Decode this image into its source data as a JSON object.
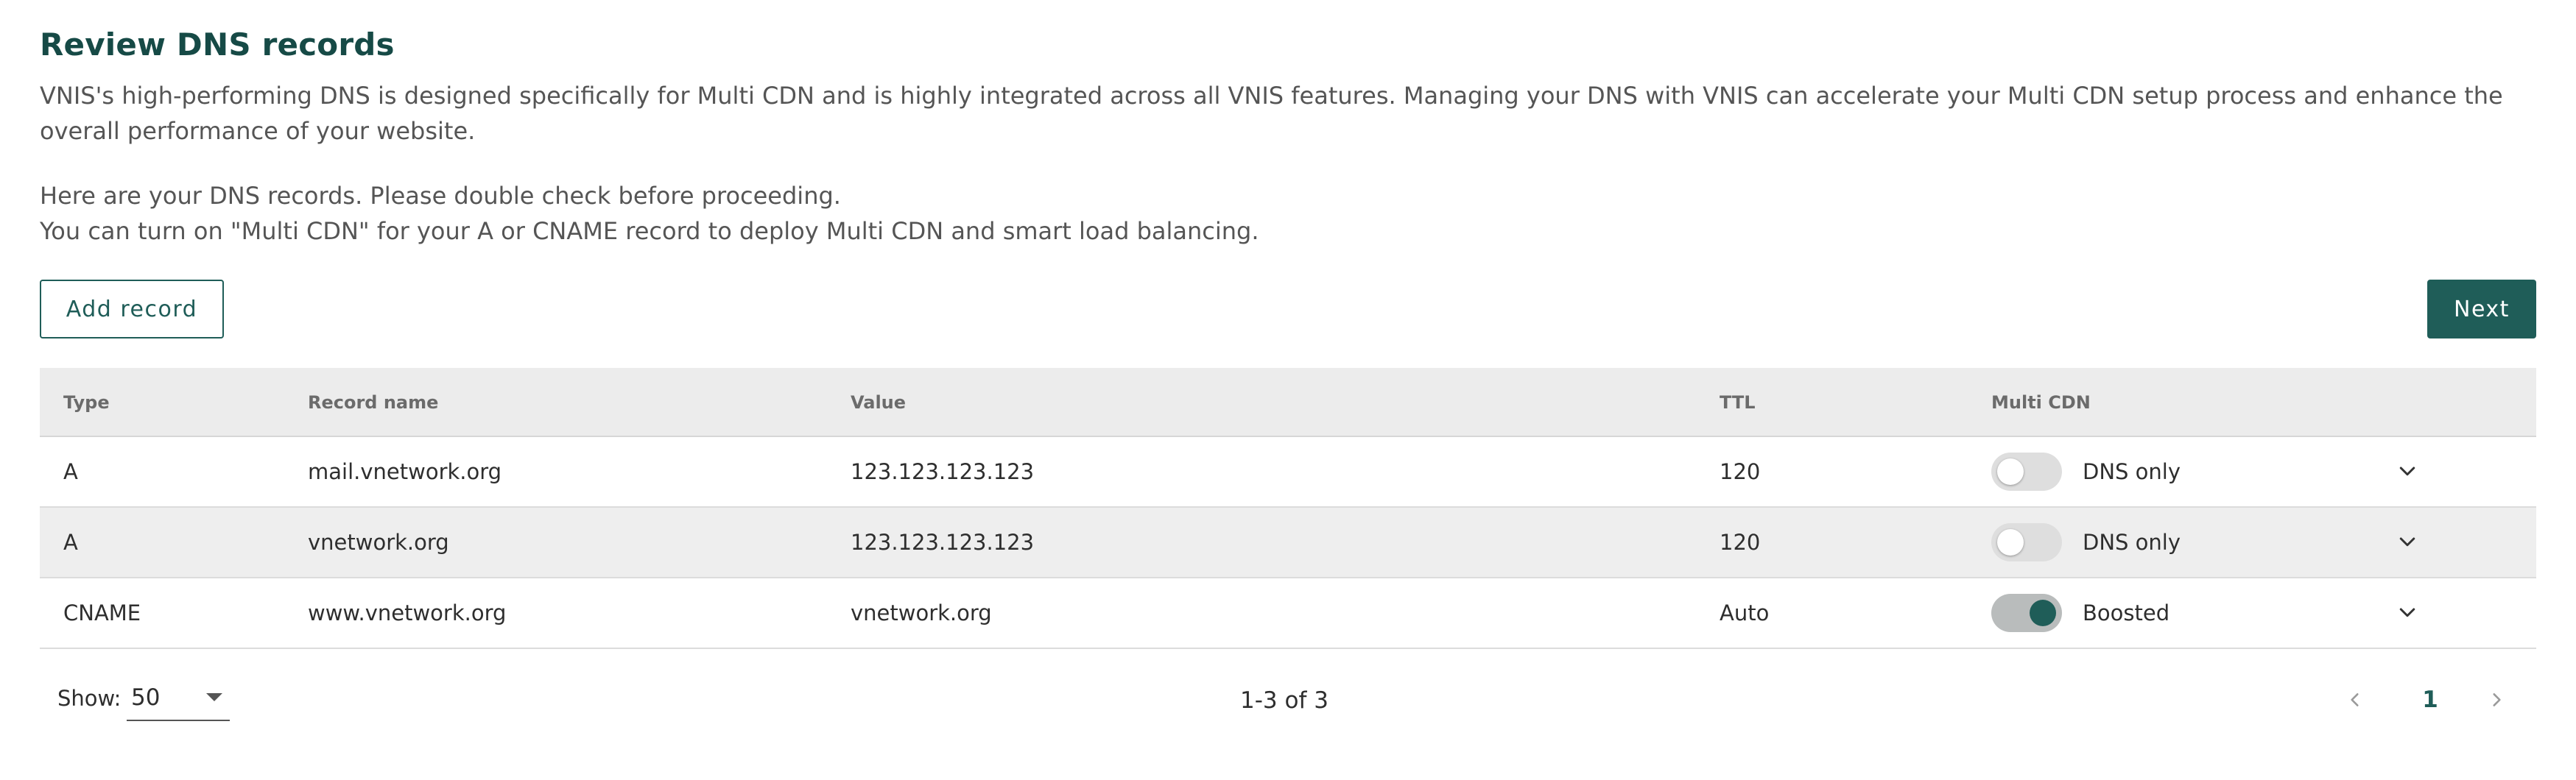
{
  "header": {
    "title": "Review DNS records",
    "description_1": "VNIS's high-performing DNS is designed specifically for Multi CDN and is highly integrated across all VNIS features. Managing your DNS with VNIS can accelerate your Multi CDN setup process and enhance the overall performance of your website.",
    "description_2": "Here are your DNS records. Please double check before proceeding.",
    "description_3": "You can turn on \"Multi CDN\" for your A or CNAME record to deploy Multi CDN and smart load balancing."
  },
  "toolbar": {
    "add_label": "Add record",
    "next_label": "Next"
  },
  "table": {
    "columns": [
      "Type",
      "Record name",
      "Value",
      "TTL",
      "Multi CDN"
    ],
    "rows": [
      {
        "type": "A",
        "name": "mail.vnetwork.org",
        "value": "123.123.123.123",
        "ttl": "120",
        "multi_cdn_on": false,
        "status": "DNS only"
      },
      {
        "type": "A",
        "name": "vnetwork.org",
        "value": "123.123.123.123",
        "ttl": "120",
        "multi_cdn_on": false,
        "status": "DNS only"
      },
      {
        "type": "CNAME",
        "name": "www.vnetwork.org",
        "value": "vnetwork.org",
        "ttl": "Auto",
        "multi_cdn_on": true,
        "status": "Boosted"
      }
    ]
  },
  "footer": {
    "show_label": "Show:",
    "page_size": "50",
    "range_text": "1-3 of 3",
    "current_page": "1"
  },
  "colors": {
    "accent": "#1f5d58",
    "title": "#164a46",
    "header_bg": "#ececec"
  },
  "icons": {
    "row_expand": "chevron-down-icon",
    "prev": "chevron-left-icon",
    "next": "chevron-right-icon",
    "select": "caret-down-icon"
  }
}
